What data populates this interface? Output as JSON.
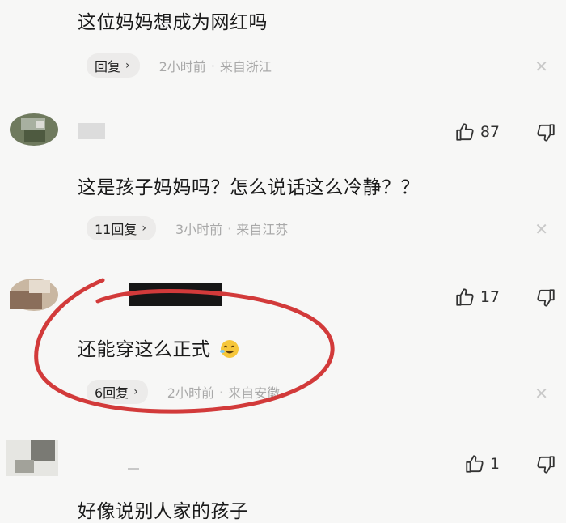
{
  "comments": [
    {
      "text": "这位妈妈想成为网红吗",
      "reply_label": "回复",
      "time": "2小时前",
      "location": "来自浙江"
    },
    {
      "text": "这是孩子妈妈吗？怎么说话这么冷静？？",
      "likes": "87",
      "reply_label": "11回复",
      "time": "3小时前",
      "location": "来自江苏"
    },
    {
      "text": "还能穿这么正式",
      "likes": "17",
      "reply_label": "6回复",
      "time": "2小时前",
      "location": "来自安徽"
    },
    {
      "text": "好像说别人家的孩子",
      "likes": "1"
    }
  ],
  "separator": "·",
  "colors": {
    "highlight_circle": "#d23a3a",
    "meta_gray": "#a9a9a9",
    "reply_bg": "#ecebea"
  },
  "icons": [
    "chevron-right-icon",
    "close-icon",
    "thumbs-up-icon",
    "thumbs-down-icon",
    "laughing-emoji-icon"
  ]
}
